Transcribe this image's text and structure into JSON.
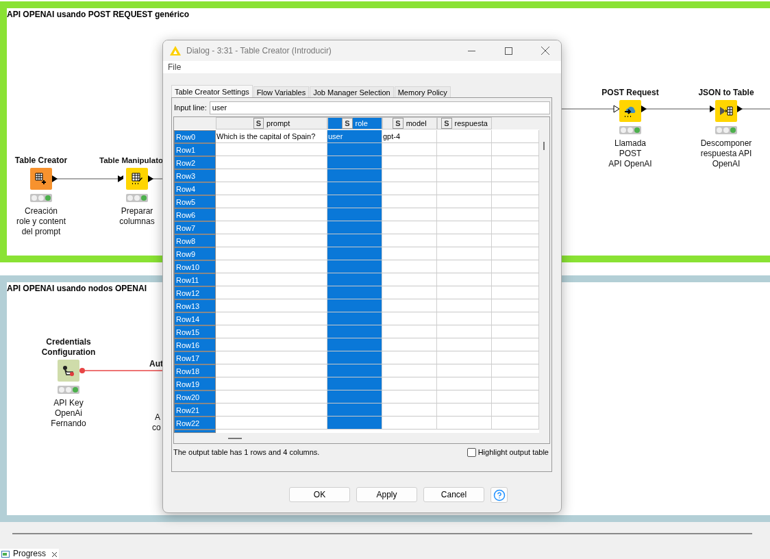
{
  "annotations": [
    {
      "title": "API OPENAI usando POST REQUEST genérico",
      "nodes": [
        {
          "kind": "creator",
          "title": "Table Creator",
          "description": "Creación\nrole y content\ndel prompt"
        },
        {
          "kind": "manipulator",
          "title": "Table Manipulato",
          "description": "Preparar\ncolumnas"
        },
        {
          "kind": "post",
          "title": "POST Request",
          "description": "Llamada\nPOST\nAPI OpenAI"
        },
        {
          "kind": "json",
          "title": "JSON to Table",
          "description": "Descomponer\nrespuesta API\nOpenAI"
        }
      ]
    },
    {
      "title": "API OPENAI usando nodos OPENAI",
      "nodes": [
        {
          "kind": "credentials",
          "title": "Credentials\nConfiguration",
          "description": "API Key\nOpenAi\nFernando"
        }
      ],
      "partial_texts": [
        {
          "kind": "title",
          "text": "Aut"
        },
        {
          "kind": "description",
          "text": "A"
        },
        {
          "kind": "description",
          "text": "co"
        }
      ]
    }
  ],
  "dialog": {
    "title": "Dialog - 3:31 - Table Creator (Introducir)",
    "menu": [
      "File"
    ],
    "tabs": [
      {
        "label": "Table Creator Settings",
        "selected": true
      },
      {
        "label": "Flow Variables",
        "selected": false
      },
      {
        "label": "Job Manager Selection",
        "selected": false
      },
      {
        "label": "Memory Policy",
        "selected": false
      }
    ],
    "input_line": {
      "label": "Input line:",
      "value": "user"
    },
    "table": {
      "columns": [
        {
          "type": "S",
          "name": "prompt",
          "selected": false
        },
        {
          "type": "S",
          "name": "role",
          "selected": true
        },
        {
          "type": "S",
          "name": "model",
          "selected": false
        },
        {
          "type": "S",
          "name": "respuesta",
          "selected": false
        }
      ],
      "rows": [
        {
          "header": "Row0",
          "cells": [
            "Which is the capital of Spain?",
            "user",
            "gpt-4"
          ]
        },
        {
          "header": "Row1"
        },
        {
          "header": "Row2"
        },
        {
          "header": "Row3"
        },
        {
          "header": "Row4"
        },
        {
          "header": "Row5"
        },
        {
          "header": "Row6"
        },
        {
          "header": "Row7"
        },
        {
          "header": "Row8"
        },
        {
          "header": "Row9"
        },
        {
          "header": "Row10"
        },
        {
          "header": "Row11"
        },
        {
          "header": "Row12"
        },
        {
          "header": "Row13"
        },
        {
          "header": "Row14"
        },
        {
          "header": "Row15"
        },
        {
          "header": "Row16"
        },
        {
          "header": "Row17"
        },
        {
          "header": "Row18"
        },
        {
          "header": "Row19"
        },
        {
          "header": "Row20"
        },
        {
          "header": "Row21"
        },
        {
          "header": "Row22"
        }
      ]
    },
    "status": "The output table has 1 rows and 4 columns.",
    "highlight": {
      "label": "Highlight output table",
      "checked": false
    },
    "buttons": [
      "OK",
      "Apply",
      "Cancel"
    ]
  },
  "bottom_tab": {
    "label": "Progress"
  }
}
